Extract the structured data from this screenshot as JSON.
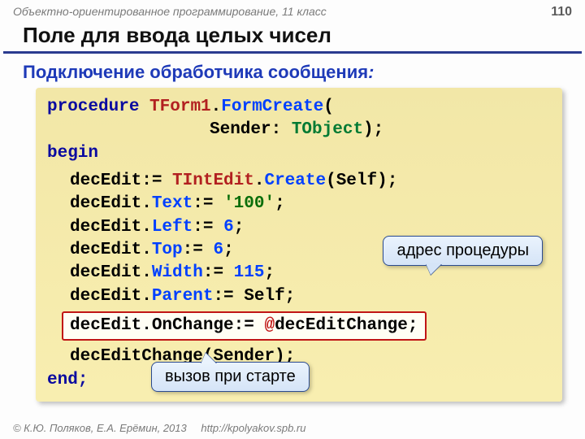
{
  "header": {
    "course": "Объектно-ориентированное программирование, 11 класс",
    "page": "110"
  },
  "title": "Поле для ввода целых чисел",
  "subtitle": "Подключение обработчика сообщения",
  "code": {
    "l1_kw": "procedure",
    "l1_type": "TForm1",
    "l1_meth": "FormCreate",
    "l2_param": "Sender:",
    "l2_type": "TObject",
    "l3_begin": "begin",
    "l4_obj": "decEdit:=",
    "l4_type": "TIntEdit",
    "l4_meth": "Create",
    "l4_arg": "(Self);",
    "l5_obj": "decEdit.",
    "l5_prop": "Text",
    "l5_rest": ":=",
    "l5_str": "'100'",
    "l6_obj": "decEdit.",
    "l6_prop": "Left",
    "l6_rest": ":=",
    "l6_num": "6",
    "l7_obj": "decEdit.",
    "l7_prop": "Top",
    "l7_rest": ":=",
    "l7_num": "6",
    "l8_obj": "decEdit.",
    "l8_prop": "Width",
    "l8_rest": ":=",
    "l8_num": "115",
    "l9_obj": "decEdit.",
    "l9_prop": "Parent",
    "l9_rest": ":= Self;",
    "hl_line": "decEdit.OnChange:=",
    "hl_at": "@",
    "hl_call": "decEditChange;",
    "l11": "decEditChange(Sender);",
    "l12_end": "end;"
  },
  "callouts": {
    "address": "адрес процедуры",
    "startup": "вызов при старте"
  },
  "footer": {
    "copyright": "© К.Ю. Поляков, Е.А. Ерёмин, 2013",
    "url": "http://kpolyakov.spb.ru"
  }
}
